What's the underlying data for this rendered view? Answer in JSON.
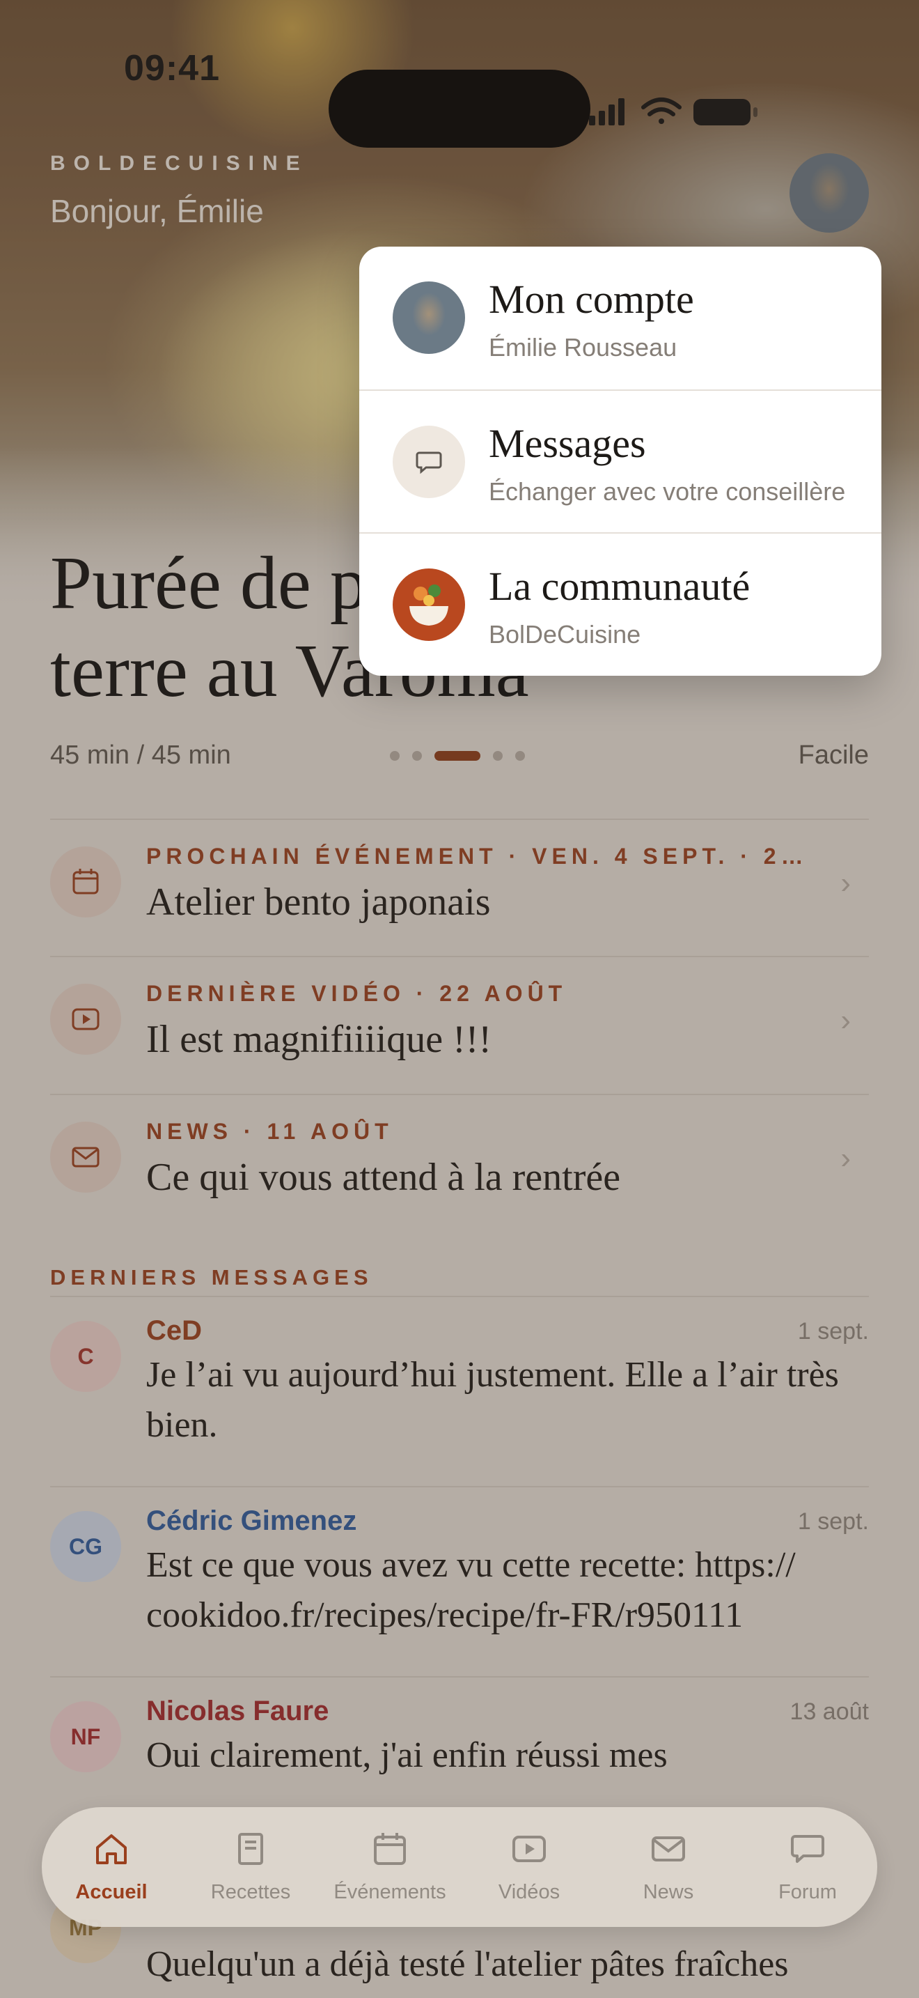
{
  "status_bar": {
    "time": "09:41"
  },
  "header": {
    "brand": "BOLDECUISINE",
    "greeting": "Bonjour, Émilie"
  },
  "hero": {
    "recipe_title_line1": "Purée de pommes de",
    "recipe_title_line2": "terre au Varoma",
    "duration": "45 min / 45 min",
    "difficulty": "Facile",
    "carousel": {
      "count": 5,
      "active_index": 2
    }
  },
  "feed": [
    {
      "kicker": "PROCHAIN ÉVÉNEMENT · VEN. 4 SEPT. · 2…",
      "title": "Atelier bento japonais",
      "icon": "calendar-icon"
    },
    {
      "kicker": "DERNIÈRE VIDÉO · 22 AOÛT",
      "title": "Il est magnifiiiique !!!",
      "icon": "play-icon"
    },
    {
      "kicker": "NEWS · 11 AOÛT",
      "title": "Ce qui vous attend à la rentrée",
      "icon": "envelope-icon"
    }
  ],
  "messages_section": {
    "heading": "DERNIERS MESSAGES",
    "items": [
      {
        "initials": "C",
        "name": "CeD",
        "date": "1 sept.",
        "text": "Je l’ai vu aujourd’hui justement. Elle a l’air très bien.",
        "name_color": "#9a3f1d",
        "avatar_bg": "#f1d4d0",
        "avatar_color": "#a4332b"
      },
      {
        "initials": "CG",
        "name": "Cédric Gimenez",
        "date": "1 sept.",
        "text": "Est ce que vous avez vu cette recette: https:// cookidoo.fr/recipes/recipe/fr-FR/r950111",
        "name_color": "#2c5aa0",
        "avatar_bg": "#d3ddef",
        "avatar_color": "#2c5aa0"
      },
      {
        "initials": "NF",
        "name": "Nicolas Faure",
        "date": "13 août",
        "text": "Oui clairement, j'ai enfin réussi mes",
        "name_color": "#a4272b",
        "avatar_bg": "#f2d3d5",
        "avatar_color": "#a4272b"
      }
    ],
    "partial_item": {
      "initials": "MP",
      "text": "Quelqu'un a déjà testé l'atelier pâtes fraîches"
    }
  },
  "account_menu": {
    "items": [
      {
        "title": "Mon compte",
        "subtitle": "Émilie Rousseau",
        "icon": "avatar-photo"
      },
      {
        "title": "Messages",
        "subtitle": "Échanger avec votre conseillère",
        "icon": "chat-bubble-icon"
      },
      {
        "title": "La communauté",
        "subtitle": "BolDeCuisine",
        "icon": "community-logo"
      }
    ]
  },
  "tab_bar": {
    "active": "Accueil",
    "tabs": [
      {
        "label": "Accueil",
        "icon": "home-icon"
      },
      {
        "label": "Recettes",
        "icon": "book-icon"
      },
      {
        "label": "Événements",
        "icon": "calendar-icon"
      },
      {
        "label": "Vidéos",
        "icon": "video-icon"
      },
      {
        "label": "News",
        "icon": "envelope-icon"
      },
      {
        "label": "Forum",
        "icon": "chat-bubble-icon"
      }
    ]
  },
  "colors": {
    "accent": "#9a3f1d",
    "background": "#e9e3dc",
    "menu_background": "#ffffff"
  }
}
